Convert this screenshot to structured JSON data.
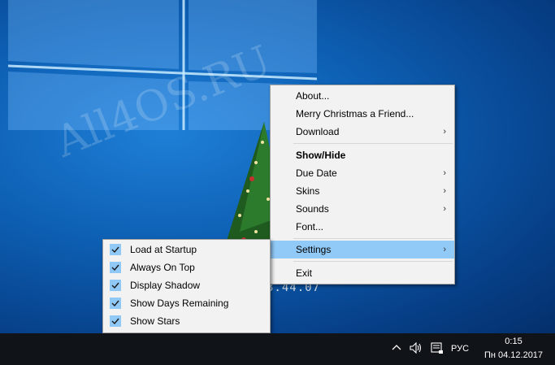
{
  "desktop": {
    "watermark": "All4OS.RU",
    "counter_readout": "3.44.07"
  },
  "main_menu": {
    "about": "About...",
    "merry": "Merry Christmas a Friend...",
    "download": "Download",
    "show_hide": "Show/Hide",
    "due_date": "Due Date",
    "skins": "Skins",
    "sounds": "Sounds",
    "font": "Font...",
    "settings": "Settings",
    "exit": "Exit"
  },
  "settings_menu": {
    "load_at_startup": "Load at Startup",
    "always_on_top": "Always On Top",
    "display_shadow": "Display Shadow",
    "show_days_remaining": "Show Days Remaining",
    "show_stars": "Show Stars"
  },
  "taskbar": {
    "language": "РУС",
    "time": "0:15",
    "date": "Пн 04.12.2017",
    "icons": [
      "chevron-up-icon",
      "volume-icon",
      "notification-icon"
    ]
  },
  "colors": {
    "highlight": "#91c9f7",
    "menu_bg": "#f2f2f2",
    "desktop_blue": "#0d5fb3",
    "taskbar": "#101418"
  }
}
